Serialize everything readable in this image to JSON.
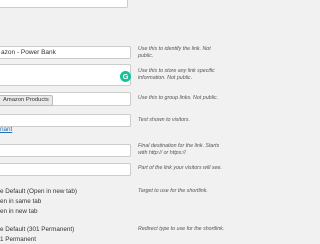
{
  "fields": {
    "title": {
      "value": "azon - Power Bank",
      "description": [
        "Use this to identify the link. Not",
        "public."
      ]
    },
    "notes": {
      "description": [
        "Use this to store any link specific",
        "information. Not public."
      ]
    },
    "groups": {
      "tag": "Amazon Products",
      "description": [
        "Use this to group links. Not public."
      ]
    },
    "text": {
      "description": [
        "Text shown to visitors."
      ]
    },
    "link_text": "riant",
    "destination": {
      "description": [
        "Final destination for the link. Starts",
        "with http:// or https://"
      ]
    },
    "shortlink": {
      "description": [
        "Part of the link your visitors will see."
      ]
    },
    "target": {
      "description": [
        "Target to use for the shortlink."
      ],
      "options": [
        "e Default (Open in new tab)",
        "en in same tab",
        "en in new tab"
      ]
    },
    "redirect": {
      "description": [
        "Redirect type to use for the shortlink."
      ],
      "options": [
        "e Default (301 Permanent)",
        "1 Permanent"
      ]
    }
  }
}
